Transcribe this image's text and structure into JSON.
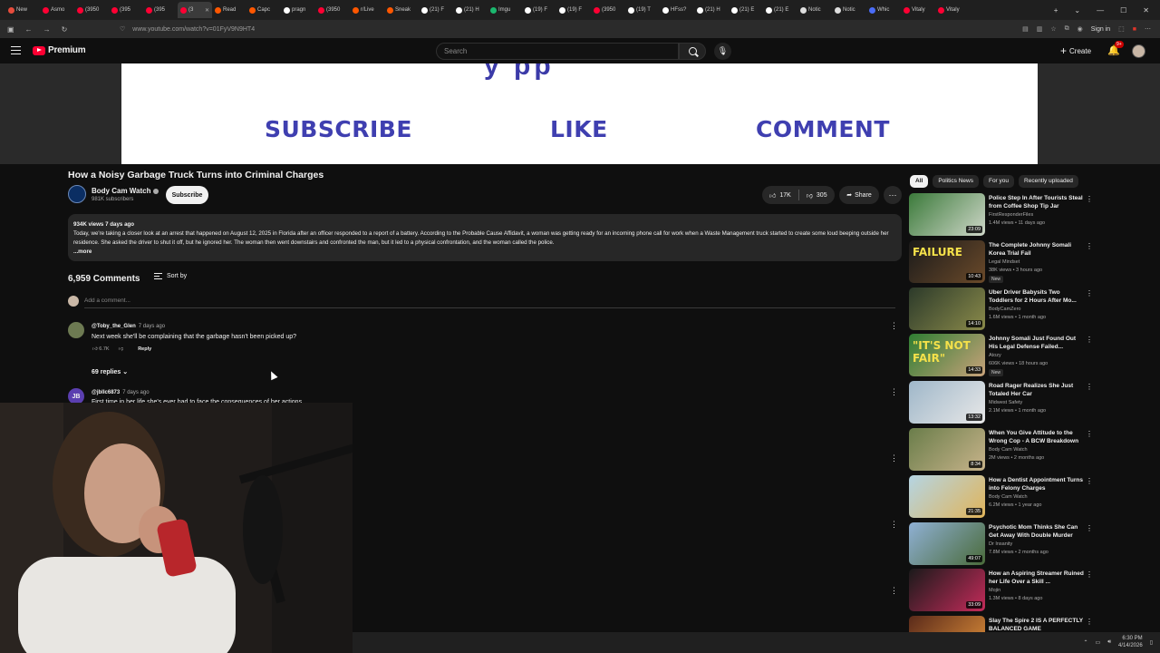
{
  "browser": {
    "tabs": [
      {
        "label": "New",
        "color": "#e74c3c"
      },
      {
        "label": "Asmo",
        "color": "#ff0033"
      },
      {
        "label": "(3950",
        "color": "#ff0033"
      },
      {
        "label": "(395",
        "color": "#ff0033"
      },
      {
        "label": "(395",
        "color": "#ff0033"
      },
      {
        "label": "(3",
        "color": "#ff0033",
        "active": true
      },
      {
        "label": "Read",
        "color": "#ff5700"
      },
      {
        "label": "Capc",
        "color": "#ff5700"
      },
      {
        "label": "pragn",
        "color": "#ffffff"
      },
      {
        "label": "(3950",
        "color": "#ff0033"
      },
      {
        "label": "r/Live",
        "color": "#ff5700"
      },
      {
        "label": "Sneak",
        "color": "#ff5700"
      },
      {
        "label": "(21) F",
        "color": "#ffffff"
      },
      {
        "label": "(21) H",
        "color": "#ffffff"
      },
      {
        "label": "Imgu",
        "color": "#1bb76e"
      },
      {
        "label": "(19) F",
        "color": "#ffffff"
      },
      {
        "label": "(19) F",
        "color": "#ffffff"
      },
      {
        "label": "(3950",
        "color": "#ff0033"
      },
      {
        "label": "(19) T",
        "color": "#ffffff"
      },
      {
        "label": "HFss?",
        "color": "#ffffff"
      },
      {
        "label": "(21) H",
        "color": "#ffffff"
      },
      {
        "label": "(21) E",
        "color": "#ffffff"
      },
      {
        "label": "(21) E",
        "color": "#ffffff"
      },
      {
        "label": "Notic",
        "color": "#dddddd"
      },
      {
        "label": "Notic",
        "color": "#dddddd"
      },
      {
        "label": "Whic",
        "color": "#4a6cf7"
      },
      {
        "label": "Vitaly",
        "color": "#ff0033"
      },
      {
        "label": "Vitaly",
        "color": "#ff0033"
      }
    ],
    "url": "www.youtube.com/watch?v=01FyV9N9HT4",
    "sign_in": "Sign in"
  },
  "header": {
    "logo": "Premium",
    "search_placeholder": "Search",
    "create": "Create",
    "notifications": "9+"
  },
  "video": {
    "banner_top": "y pp",
    "cta": [
      "SUBSCRIBE",
      "LIKE",
      "COMMENT"
    ],
    "title": "How a Noisy Garbage Truck Turns into Criminal Charges",
    "channel": "Body Cam Watch",
    "subscribers": "981K subscribers",
    "subscribe": "Subscribe",
    "likes": "17K",
    "dislikes": "305",
    "share": "Share"
  },
  "description": {
    "meta": "934K views  7 days ago",
    "text": "Today, we're taking a closer look at an arrest that happened on August 12, 2025 in Florida after an officer responded to a report of a battery. According to the Probable Cause Affidavit, a woman was getting ready for an incoming phone call for work when a Waste Management truck started to create some loud beeping outside her residence. She asked the driver to shut it off, but he ignored her. The woman then went downstairs and confronted the man, but it led to a physical confrontation, and the woman called the police.",
    "more": "...more"
  },
  "comments": {
    "count": "6,959 Comments",
    "sort": "Sort by",
    "add_placeholder": "Add a comment...",
    "items": [
      {
        "author": "@Toby_the_Glen",
        "time": "7 days ago",
        "text": "Next week she'll be complaining that the garbage hasn't been picked up?",
        "likes": "6.7K",
        "reply": "Reply",
        "replies": "69 replies"
      },
      {
        "author": "@jbllc6873",
        "initials": "JB",
        "time": "7 days ago",
        "text": "First time in her life she's ever had to face the consequences of her actions"
      }
    ]
  },
  "sidebar": {
    "chips": [
      "All",
      "Politics News",
      "For you",
      "Recently uploaded"
    ],
    "recommendations": [
      {
        "title": "Police Step In After Tourists Steal from Coffee Shop Tip Jar",
        "channel": "FirstResponderFiles",
        "meta": "1.4M views • 11 days ago",
        "duration": "23:09",
        "colors": [
          "#3b7a3a",
          "#cfd7c9"
        ]
      },
      {
        "title": "The Complete Johnny Somali Korea Trial Fail",
        "channel": "Legal Mindset",
        "meta": "38K views • 3 hours ago",
        "duration": "10:43",
        "new": "New",
        "thumb_text": "FAILURE",
        "colors": [
          "#1a1a1a",
          "#6b4a2a"
        ]
      },
      {
        "title": "Uber Driver Babysits Two Toddlers for 2 Hours After Mo...",
        "channel": "BodyCamZero",
        "meta": "1.6M views • 1 month ago",
        "duration": "14:10",
        "colors": [
          "#2c3a2a",
          "#8a8a4a"
        ]
      },
      {
        "title": "Johnny Somali Just Found Out His Legal Defense Failed...",
        "channel": "Atozy",
        "meta": "606K views • 18 hours ago",
        "duration": "14:33",
        "new": "New",
        "thumb_text": "\"IT'S NOT FAIR\"",
        "colors": [
          "#2e7d32",
          "#c8a27a"
        ]
      },
      {
        "title": "Road Rager Realizes She Just Totaled Her Car",
        "channel": "Midwest Safety",
        "meta": "2.1M views • 1 month ago",
        "duration": "13:32",
        "colors": [
          "#9fb7c9",
          "#e8e8e8"
        ]
      },
      {
        "title": "When You Give Attitude to the Wrong Cop - A BCW Breakdown",
        "channel": "Body Cam Watch",
        "meta": "2M views • 2 months ago",
        "duration": "8:34",
        "colors": [
          "#6a7d4a",
          "#c7b38a"
        ]
      },
      {
        "title": "How a Dentist Appointment Turns into Felony Charges",
        "channel": "Body Cam Watch",
        "meta": "6.2M views • 1 year ago",
        "duration": "21:35",
        "colors": [
          "#b5d5e3",
          "#e0b45a"
        ]
      },
      {
        "title": "Psychotic Mom Thinks She Can Get Away With Double Murder",
        "channel": "Dr Insanity",
        "meta": "7.8M views • 2 months ago",
        "duration": "49:07",
        "colors": [
          "#8fb0d4",
          "#4a6b3a"
        ]
      },
      {
        "title": "How an Aspiring Streamer Ruined her Life Over a Skill ...",
        "channel": "Mojin",
        "meta": "1.3M views • 8 days ago",
        "duration": "33:09",
        "colors": [
          "#1a1a1a",
          "#c42b5a"
        ]
      },
      {
        "title": "Slay The Spire 2 IS A PERFECTLY BALANCED GAME",
        "channel": "",
        "meta": "",
        "duration": "",
        "colors": [
          "#5a2a1a",
          "#e0903a"
        ]
      }
    ]
  },
  "taskbar": {
    "time": "6:30 PM",
    "date": "4/14/2026"
  }
}
